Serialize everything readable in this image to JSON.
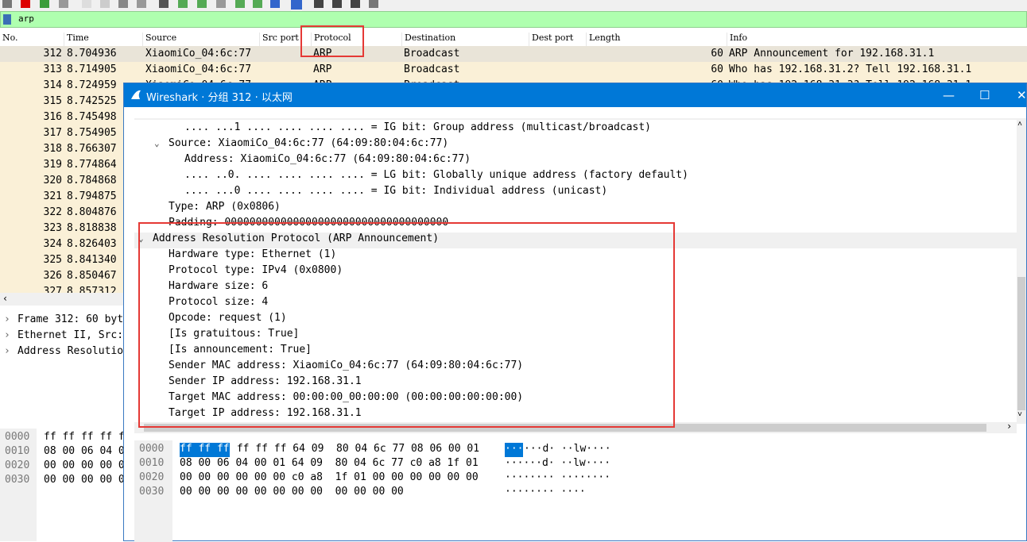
{
  "filter": {
    "value": "arp"
  },
  "columns": [
    "No.",
    "Time",
    "Source",
    "Src port",
    "Protocol",
    "Destination",
    "Dest port",
    "Length",
    "Info"
  ],
  "packets": [
    {
      "no": "312",
      "time": "8.704936",
      "src": "XiaomiCo_04:6c:77",
      "proto": "ARP",
      "dst": "Broadcast",
      "len": "60",
      "info": "ARP Announcement for 192.168.31.1"
    },
    {
      "no": "313",
      "time": "8.714905",
      "src": "XiaomiCo_04:6c:77",
      "proto": "ARP",
      "dst": "Broadcast",
      "len": "60",
      "info": "Who has 192.168.31.2? Tell 192.168.31.1"
    },
    {
      "no": "314",
      "time": "8.724959",
      "src": "XiaomiCo_04:6c:77",
      "proto": "ARP",
      "dst": "Broadcast",
      "len": "60",
      "info": "Who has 192.168.31.3? Tell 192.168.31.1"
    },
    {
      "no": "315",
      "time": "8.742525"
    },
    {
      "no": "316",
      "time": "8.745498"
    },
    {
      "no": "317",
      "time": "8.754905"
    },
    {
      "no": "318",
      "time": "8.766307"
    },
    {
      "no": "319",
      "time": "8.774864"
    },
    {
      "no": "320",
      "time": "8.784868"
    },
    {
      "no": "321",
      "time": "8.794875"
    },
    {
      "no": "322",
      "time": "8.804876"
    },
    {
      "no": "323",
      "time": "8.818838"
    },
    {
      "no": "324",
      "time": "8.826403"
    },
    {
      "no": "325",
      "time": "8.841340"
    },
    {
      "no": "326",
      "time": "8.850467"
    },
    {
      "no": "327",
      "time": "8.857312"
    }
  ],
  "left_detail": [
    "Frame 312: 60 byt",
    "Ethernet II, Src:",
    "Address Resolutio"
  ],
  "left_hex": [
    {
      "off": "0000",
      "bytes": "ff ff ff ff f"
    },
    {
      "off": "0010",
      "bytes": "08 00 06 04 0"
    },
    {
      "off": "0020",
      "bytes": "00 00 00 00 0"
    },
    {
      "off": "0030",
      "bytes": "00 00 00 00 0"
    }
  ],
  "dialog": {
    "title": "Wireshark · 分组 312 · 以太网",
    "min": "—",
    "max": "☐",
    "close": "✕",
    "detail_lines": [
      {
        "indent": 3,
        "arrow": "",
        "text": ".... ...1 .... .... .... .... = IG bit: Group address (multicast/broadcast)"
      },
      {
        "indent": 2,
        "arrow": "v",
        "text": "Source: XiaomiCo_04:6c:77 (64:09:80:04:6c:77)"
      },
      {
        "indent": 3,
        "arrow": "",
        "text": "Address: XiaomiCo_04:6c:77 (64:09:80:04:6c:77)"
      },
      {
        "indent": 3,
        "arrow": "",
        "text": ".... ..0. .... .... .... .... = LG bit: Globally unique address (factory default)"
      },
      {
        "indent": 3,
        "arrow": "",
        "text": ".... ...0 .... .... .... .... = IG bit: Individual address (unicast)"
      },
      {
        "indent": 2,
        "arrow": "",
        "text": "Type: ARP (0x0806)"
      },
      {
        "indent": 2,
        "arrow": "",
        "text": "Padding: 000000000000000000000000000000000000"
      },
      {
        "indent": 1,
        "arrow": "v",
        "text": "Address Resolution Protocol (ARP Announcement)"
      },
      {
        "indent": 2,
        "arrow": "",
        "text": "Hardware type: Ethernet (1)"
      },
      {
        "indent": 2,
        "arrow": "",
        "text": "Protocol type: IPv4 (0x0800)"
      },
      {
        "indent": 2,
        "arrow": "",
        "text": "Hardware size: 6"
      },
      {
        "indent": 2,
        "arrow": "",
        "text": "Protocol size: 4"
      },
      {
        "indent": 2,
        "arrow": "",
        "text": "Opcode: request (1)"
      },
      {
        "indent": 2,
        "arrow": "",
        "text": "[Is gratuitous: True]"
      },
      {
        "indent": 2,
        "arrow": "",
        "text": "[Is announcement: True]"
      },
      {
        "indent": 2,
        "arrow": "",
        "text": "Sender MAC address: XiaomiCo_04:6c:77 (64:09:80:04:6c:77)"
      },
      {
        "indent": 2,
        "arrow": "",
        "text": "Sender IP address: 192.168.31.1"
      },
      {
        "indent": 2,
        "arrow": "",
        "text": "Target MAC address: 00:00:00_00:00:00 (00:00:00:00:00:00)"
      },
      {
        "indent": 2,
        "arrow": "",
        "text": "Target IP address: 192.168.31.1"
      }
    ],
    "hex_lines": [
      {
        "off": "0000",
        "hl": "ff ff ff",
        "bytes": " ff ff ff 64 09  80 04 6c 77 08 06 00 01",
        "ascii_hl": "···",
        "ascii": "···d· ··lw····"
      },
      {
        "off": "0010",
        "hl": "",
        "bytes": "08 00 06 04 00 01 64 09  80 04 6c 77 c0 a8 1f 01",
        "ascii_hl": "",
        "ascii": "······d· ··lw····"
      },
      {
        "off": "0020",
        "hl": "",
        "bytes": "00 00 00 00 00 00 c0 a8  1f 01 00 00 00 00 00 00",
        "ascii_hl": "",
        "ascii": "········ ········"
      },
      {
        "off": "0030",
        "hl": "",
        "bytes": "00 00 00 00 00 00 00 00  00 00 00 00",
        "ascii_hl": "",
        "ascii": "········ ····"
      }
    ]
  }
}
